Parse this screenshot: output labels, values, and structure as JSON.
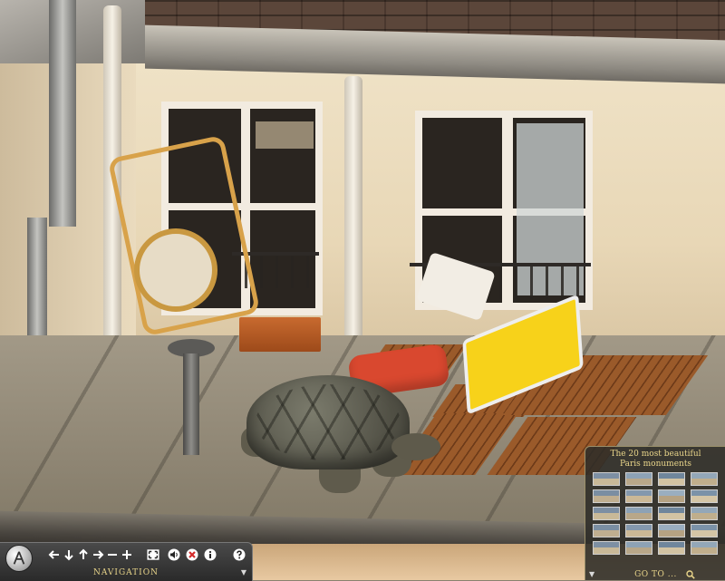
{
  "navigation": {
    "label": "NAVIGATION",
    "controls": [
      {
        "name": "logo-icon",
        "type": "logo"
      },
      {
        "name": "pan-left-button",
        "icon": "arrow-left-icon"
      },
      {
        "name": "pan-down-button",
        "icon": "arrow-down-icon"
      },
      {
        "name": "pan-up-button",
        "icon": "arrow-up-icon"
      },
      {
        "name": "pan-right-button",
        "icon": "arrow-right-icon"
      },
      {
        "name": "zoom-out-button",
        "icon": "minus-icon"
      },
      {
        "name": "zoom-in-button",
        "icon": "plus-icon"
      },
      {
        "name": "fullscreen-button",
        "icon": "fullscreen-icon"
      },
      {
        "name": "sound-button",
        "icon": "speaker-icon"
      },
      {
        "name": "hotspots-toggle-button",
        "icon": "cancel-circle-icon"
      },
      {
        "name": "info-button",
        "icon": "info-icon"
      },
      {
        "name": "help-button",
        "icon": "help-icon"
      }
    ]
  },
  "monuments": {
    "title_line1": "The 20 most beautiful",
    "title_line2": "Paris monuments",
    "goto_label": "GO TO ...",
    "thumbnails": [
      {
        "name": "monument-1"
      },
      {
        "name": "monument-2"
      },
      {
        "name": "monument-3"
      },
      {
        "name": "monument-4"
      },
      {
        "name": "monument-5"
      },
      {
        "name": "monument-6"
      },
      {
        "name": "monument-7"
      },
      {
        "name": "monument-8"
      },
      {
        "name": "monument-9"
      },
      {
        "name": "monument-10"
      },
      {
        "name": "monument-11"
      },
      {
        "name": "monument-12"
      },
      {
        "name": "monument-13"
      },
      {
        "name": "monument-14"
      },
      {
        "name": "monument-15"
      },
      {
        "name": "monument-16"
      },
      {
        "name": "monument-17"
      },
      {
        "name": "monument-18"
      },
      {
        "name": "monument-19"
      },
      {
        "name": "monument-20"
      }
    ]
  },
  "colors": {
    "accent_gold": "#e9d58a",
    "bar_dark": "#2a2a2a",
    "panel_bg": "#2e2c28",
    "cancel_red": "#d42a2a"
  }
}
